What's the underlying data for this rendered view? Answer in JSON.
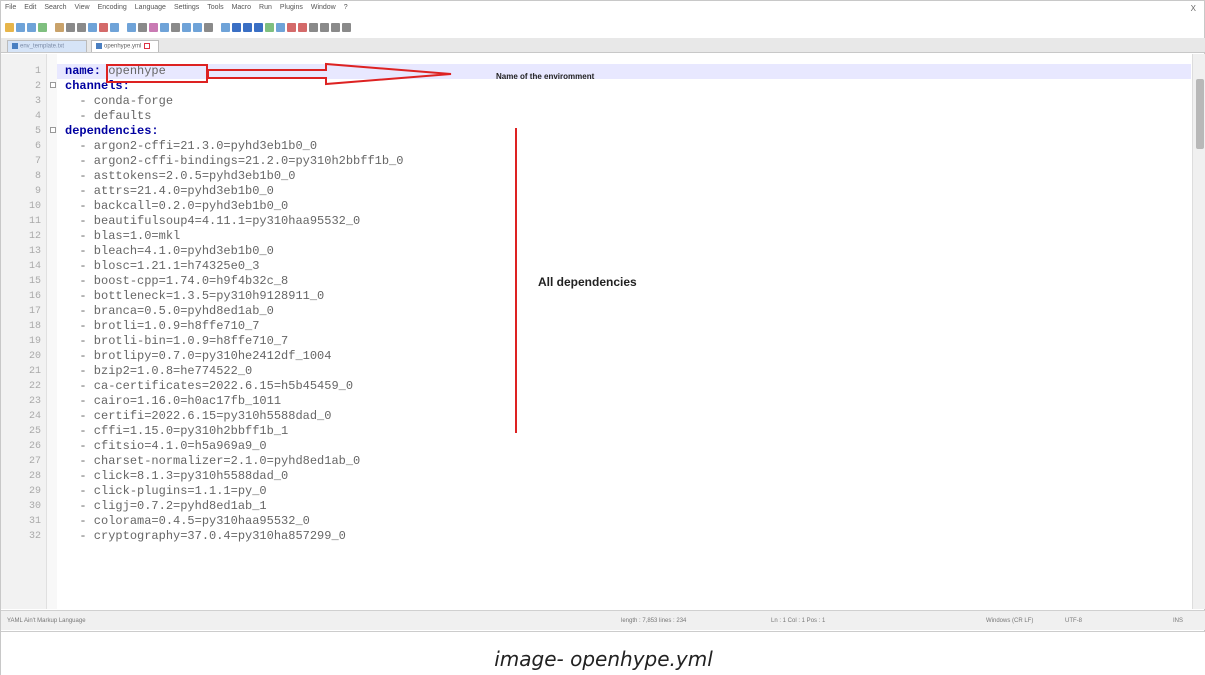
{
  "menu": [
    "File",
    "Edit",
    "Search",
    "View",
    "Encoding",
    "Language",
    "Settings",
    "Tools",
    "Macro",
    "Run",
    "Plugins",
    "Window",
    "?"
  ],
  "window_close": "X",
  "tabs": [
    {
      "label": "env_template.txt"
    },
    {
      "label": "openhype.yml"
    }
  ],
  "lines": [
    {
      "n": "1",
      "indent": "",
      "key": "name:",
      "val": " openhype"
    },
    {
      "n": "2",
      "indent": "",
      "key": "channels:",
      "val": ""
    },
    {
      "n": "3",
      "indent": "  ",
      "key": "",
      "val": "- conda-forge"
    },
    {
      "n": "4",
      "indent": "  ",
      "key": "",
      "val": "- defaults"
    },
    {
      "n": "5",
      "indent": "",
      "key": "dependencies:",
      "val": ""
    },
    {
      "n": "6",
      "indent": "  ",
      "key": "",
      "val": "- argon2-cffi=21.3.0=pyhd3eb1b0_0"
    },
    {
      "n": "7",
      "indent": "  ",
      "key": "",
      "val": "- argon2-cffi-bindings=21.2.0=py310h2bbff1b_0"
    },
    {
      "n": "8",
      "indent": "  ",
      "key": "",
      "val": "- asttokens=2.0.5=pyhd3eb1b0_0"
    },
    {
      "n": "9",
      "indent": "  ",
      "key": "",
      "val": "- attrs=21.4.0=pyhd3eb1b0_0"
    },
    {
      "n": "10",
      "indent": "  ",
      "key": "",
      "val": "- backcall=0.2.0=pyhd3eb1b0_0"
    },
    {
      "n": "11",
      "indent": "  ",
      "key": "",
      "val": "- beautifulsoup4=4.11.1=py310haa95532_0"
    },
    {
      "n": "12",
      "indent": "  ",
      "key": "",
      "val": "- blas=1.0=mkl"
    },
    {
      "n": "13",
      "indent": "  ",
      "key": "",
      "val": "- bleach=4.1.0=pyhd3eb1b0_0"
    },
    {
      "n": "14",
      "indent": "  ",
      "key": "",
      "val": "- blosc=1.21.1=h74325e0_3"
    },
    {
      "n": "15",
      "indent": "  ",
      "key": "",
      "val": "- boost-cpp=1.74.0=h9f4b32c_8"
    },
    {
      "n": "16",
      "indent": "  ",
      "key": "",
      "val": "- bottleneck=1.3.5=py310h9128911_0"
    },
    {
      "n": "17",
      "indent": "  ",
      "key": "",
      "val": "- branca=0.5.0=pyhd8ed1ab_0"
    },
    {
      "n": "18",
      "indent": "  ",
      "key": "",
      "val": "- brotli=1.0.9=h8ffe710_7"
    },
    {
      "n": "19",
      "indent": "  ",
      "key": "",
      "val": "- brotli-bin=1.0.9=h8ffe710_7"
    },
    {
      "n": "20",
      "indent": "  ",
      "key": "",
      "val": "- brotlipy=0.7.0=py310he2412df_1004"
    },
    {
      "n": "21",
      "indent": "  ",
      "key": "",
      "val": "- bzip2=1.0.8=he774522_0"
    },
    {
      "n": "22",
      "indent": "  ",
      "key": "",
      "val": "- ca-certificates=2022.6.15=h5b45459_0"
    },
    {
      "n": "23",
      "indent": "  ",
      "key": "",
      "val": "- cairo=1.16.0=h0ac17fb_1011"
    },
    {
      "n": "24",
      "indent": "  ",
      "key": "",
      "val": "- certifi=2022.6.15=py310h5588dad_0"
    },
    {
      "n": "25",
      "indent": "  ",
      "key": "",
      "val": "- cffi=1.15.0=py310h2bbff1b_1"
    },
    {
      "n": "26",
      "indent": "  ",
      "key": "",
      "val": "- cfitsio=4.1.0=h5a969a9_0"
    },
    {
      "n": "27",
      "indent": "  ",
      "key": "",
      "val": "- charset-normalizer=2.1.0=pyhd8ed1ab_0"
    },
    {
      "n": "28",
      "indent": "  ",
      "key": "",
      "val": "- click=8.1.3=py310h5588dad_0"
    },
    {
      "n": "29",
      "indent": "  ",
      "key": "",
      "val": "- click-plugins=1.1.1=py_0"
    },
    {
      "n": "30",
      "indent": "  ",
      "key": "",
      "val": "- cligj=0.7.2=pyhd8ed1ab_1"
    },
    {
      "n": "31",
      "indent": "  ",
      "key": "",
      "val": "- colorama=0.4.5=py310haa95532_0"
    },
    {
      "n": "32",
      "indent": "  ",
      "key": "",
      "val": "- cryptography=37.0.4=py310ha857299_0"
    }
  ],
  "annotations": {
    "env_label": "Name of the enviromment",
    "deps_label": "All dependencies"
  },
  "status": {
    "language": "YAML Ain't Markup Language",
    "length": "length : 7,853   lines : 234",
    "position": "Ln : 1   Col : 1   Pos : 1",
    "eol": "Windows (CR LF)",
    "encoding": "UTF-8",
    "mode": "INS"
  },
  "caption": "image- openhype.yml",
  "colors": {
    "accent_red": "#dd2222",
    "key_blue": "#0000a0",
    "current_line": "#e8e8ff"
  }
}
